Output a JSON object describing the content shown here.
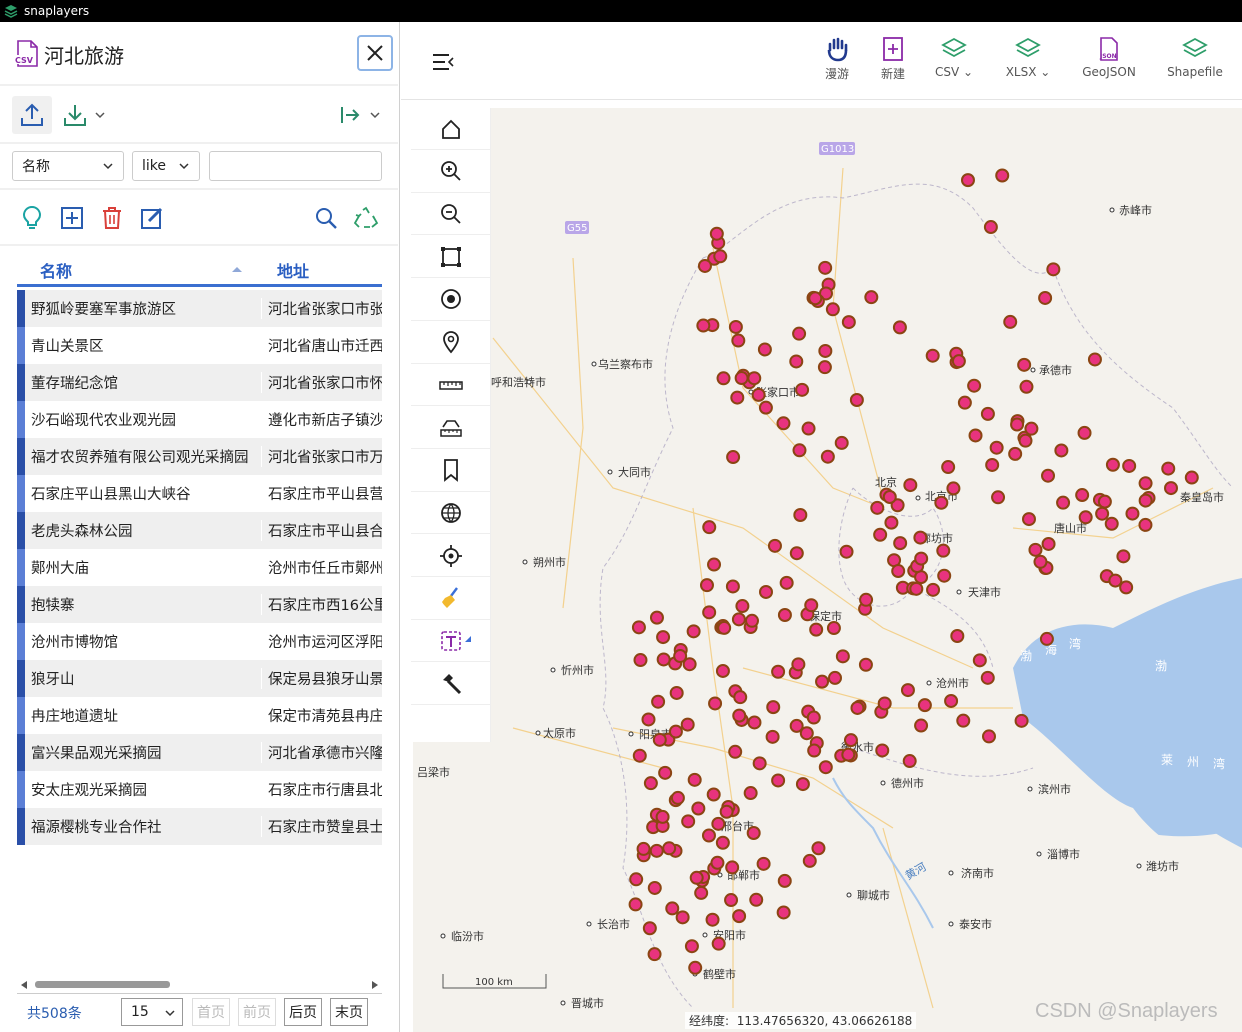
{
  "app": {
    "title": "snaplayers"
  },
  "panel": {
    "title": "河北旅游",
    "filter": {
      "field": "名称",
      "operator": "like",
      "value": ""
    },
    "columns": [
      "名称",
      "地址"
    ],
    "rows": [
      {
        "name": "野狐岭要塞军事旅游区",
        "addr": "河北省张家口市张"
      },
      {
        "name": "青山关景区",
        "addr": "河北省唐山市迁西"
      },
      {
        "name": "董存瑞纪念馆",
        "addr": "河北省张家口市怀"
      },
      {
        "name": "沙石峪现代农业观光园",
        "addr": "遵化市新店子镇沙"
      },
      {
        "name": "福才农贸养殖有限公司观光采摘园",
        "addr": "河北省张家口市万"
      },
      {
        "name": "石家庄平山县黑山大峡谷",
        "addr": "石家庄市平山县营"
      },
      {
        "name": "老虎头森林公园",
        "addr": "石家庄市平山县合"
      },
      {
        "name": "鄚州大庙",
        "addr": "沧州市任丘市鄚州"
      },
      {
        "name": "抱犊寨",
        "addr": "石家庄市西16公里"
      },
      {
        "name": "沧州市博物馆",
        "addr": "沧州市运河区浮阳"
      },
      {
        "name": "狼牙山",
        "addr": "保定易县狼牙山景"
      },
      {
        "name": "冉庄地道遗址",
        "addr": "保定市清苑县冉庄"
      },
      {
        "name": "富兴果品观光采摘园",
        "addr": "河北省承德市兴隆"
      },
      {
        "name": "安太庄观光采摘园",
        "addr": "石家庄市行唐县北"
      },
      {
        "name": "福源樱桃专业合作社",
        "addr": "石家庄市赞皇县士"
      }
    ],
    "pagination": {
      "total": "共508条",
      "page_size": "15",
      "first": "首页",
      "prev": "前页",
      "next": "后页",
      "last": "末页"
    }
  },
  "toolbar": {
    "items": [
      {
        "label": "漫游"
      },
      {
        "label": "新建"
      },
      {
        "label": "CSV"
      },
      {
        "label": "XLSX"
      },
      {
        "label": "GeoJSON"
      },
      {
        "label": "Shapefile"
      }
    ]
  },
  "map": {
    "cities": [
      "乌兰察布市",
      "呼和浩特市",
      "张家口市",
      "承德市",
      "赤峰市",
      "大同市",
      "北京",
      "北京市",
      "秦皇岛市",
      "唐山市",
      "廊坊市",
      "朔州市",
      "天津市",
      "保定市",
      "忻州市",
      "沧州市",
      "太原市",
      "阳泉市",
      "衡水市",
      "吕梁市",
      "德州市",
      "滨州市",
      "邢台市",
      "淄博市",
      "潍坊市",
      "邯郸市",
      "济南市",
      "聊城市",
      "长治市",
      "泰安市",
      "临汾市",
      "安阳市",
      "鹤壁市",
      "晋城市"
    ],
    "seas": [
      "渤",
      "海",
      "湾",
      "渤",
      "莱",
      "州",
      "湾"
    ],
    "scale": "100 km",
    "coord_label": "经纬度:",
    "coord_value": "113.47656320, 43.06626188",
    "road_labels": [
      "G1013",
      "G55"
    ],
    "river": "黄河",
    "point_color": "#e8337e",
    "point_stroke": "#8b4513",
    "watermark": "CSDN @Snaplayers"
  }
}
